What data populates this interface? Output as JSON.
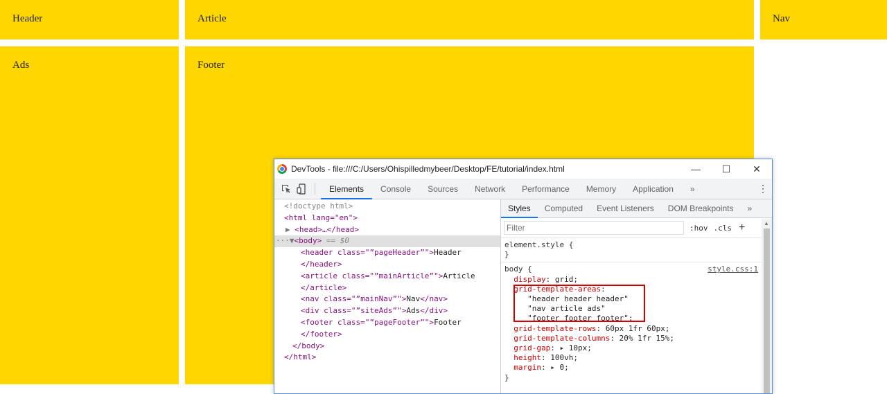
{
  "page": {
    "header": "Header",
    "article": "Article",
    "nav": "Nav",
    "ads": "Ads",
    "footer": "Footer"
  },
  "colors": {
    "box": "#ffd700",
    "accent": "#1a73e8",
    "highlight": "#d40000"
  },
  "devtools": {
    "title": "DevTools - file:///C:/Users/Ohispilledmybeer/Desktop/FE/tutorial/index.html",
    "window_buttons": {
      "minimize": "—",
      "maximize": "☐",
      "close": "✕"
    },
    "tabs": [
      "Elements",
      "Console",
      "Sources",
      "Network",
      "Performance",
      "Memory",
      "Application"
    ],
    "more_tabs": "»",
    "kebab": "⋮",
    "elements": {
      "doctype": "<!doctype html>",
      "html_open": "<html lang=\"en\">",
      "head": "<head>…</head>",
      "body_open": "<body>",
      "body_marker": "== $0",
      "header_open": "<header class=\"”pageHeader”\">",
      "header_text": "Header",
      "header_close": "</header>",
      "article_open": "<article class=\"”mainArticle”\">",
      "article_text": "Article",
      "article_close": "</article>",
      "nav_open": "<nav class=\"”mainNav”\">",
      "nav_text": "Nav",
      "nav_close": "</nav>",
      "div_open": "<div class=\"”siteAds”\">",
      "div_text": "Ads",
      "div_close": "</div>",
      "footer_open": "<footer class=\"”pageFooter”\">",
      "footer_text": "Footer",
      "footer_close": "</footer>",
      "body_close": "</body>",
      "html_close": "</html>"
    },
    "styles": {
      "sub_tabs": [
        "Styles",
        "Computed",
        "Event Listeners",
        "DOM Breakpoints"
      ],
      "sub_more": "»",
      "filter_placeholder": "Filter",
      "hov": ":hov",
      "cls": ".cls",
      "plus": "+",
      "element_style_open": "element.style {",
      "element_style_close": "}",
      "body_selector": "body {",
      "source": "style.css:1",
      "rules": {
        "display_prop": "display",
        "display_val": "grid;",
        "areas_prop": "grid-template-areas",
        "areas_1": "\"header header header\"",
        "areas_2": "\"nav article ads\"",
        "areas_3": "\"footer footer footer\";",
        "rows_prop": "grid-template-rows",
        "rows_val": "60px 1fr 60px;",
        "cols_prop": "grid-template-columns",
        "cols_val": "20% 1fr 15%;",
        "gap_prop": "grid-gap",
        "gap_val": "10px;",
        "height_prop": "height",
        "height_val": "100vh;",
        "margin_prop": "margin",
        "margin_val": "0;"
      },
      "close_brace": "}"
    }
  }
}
